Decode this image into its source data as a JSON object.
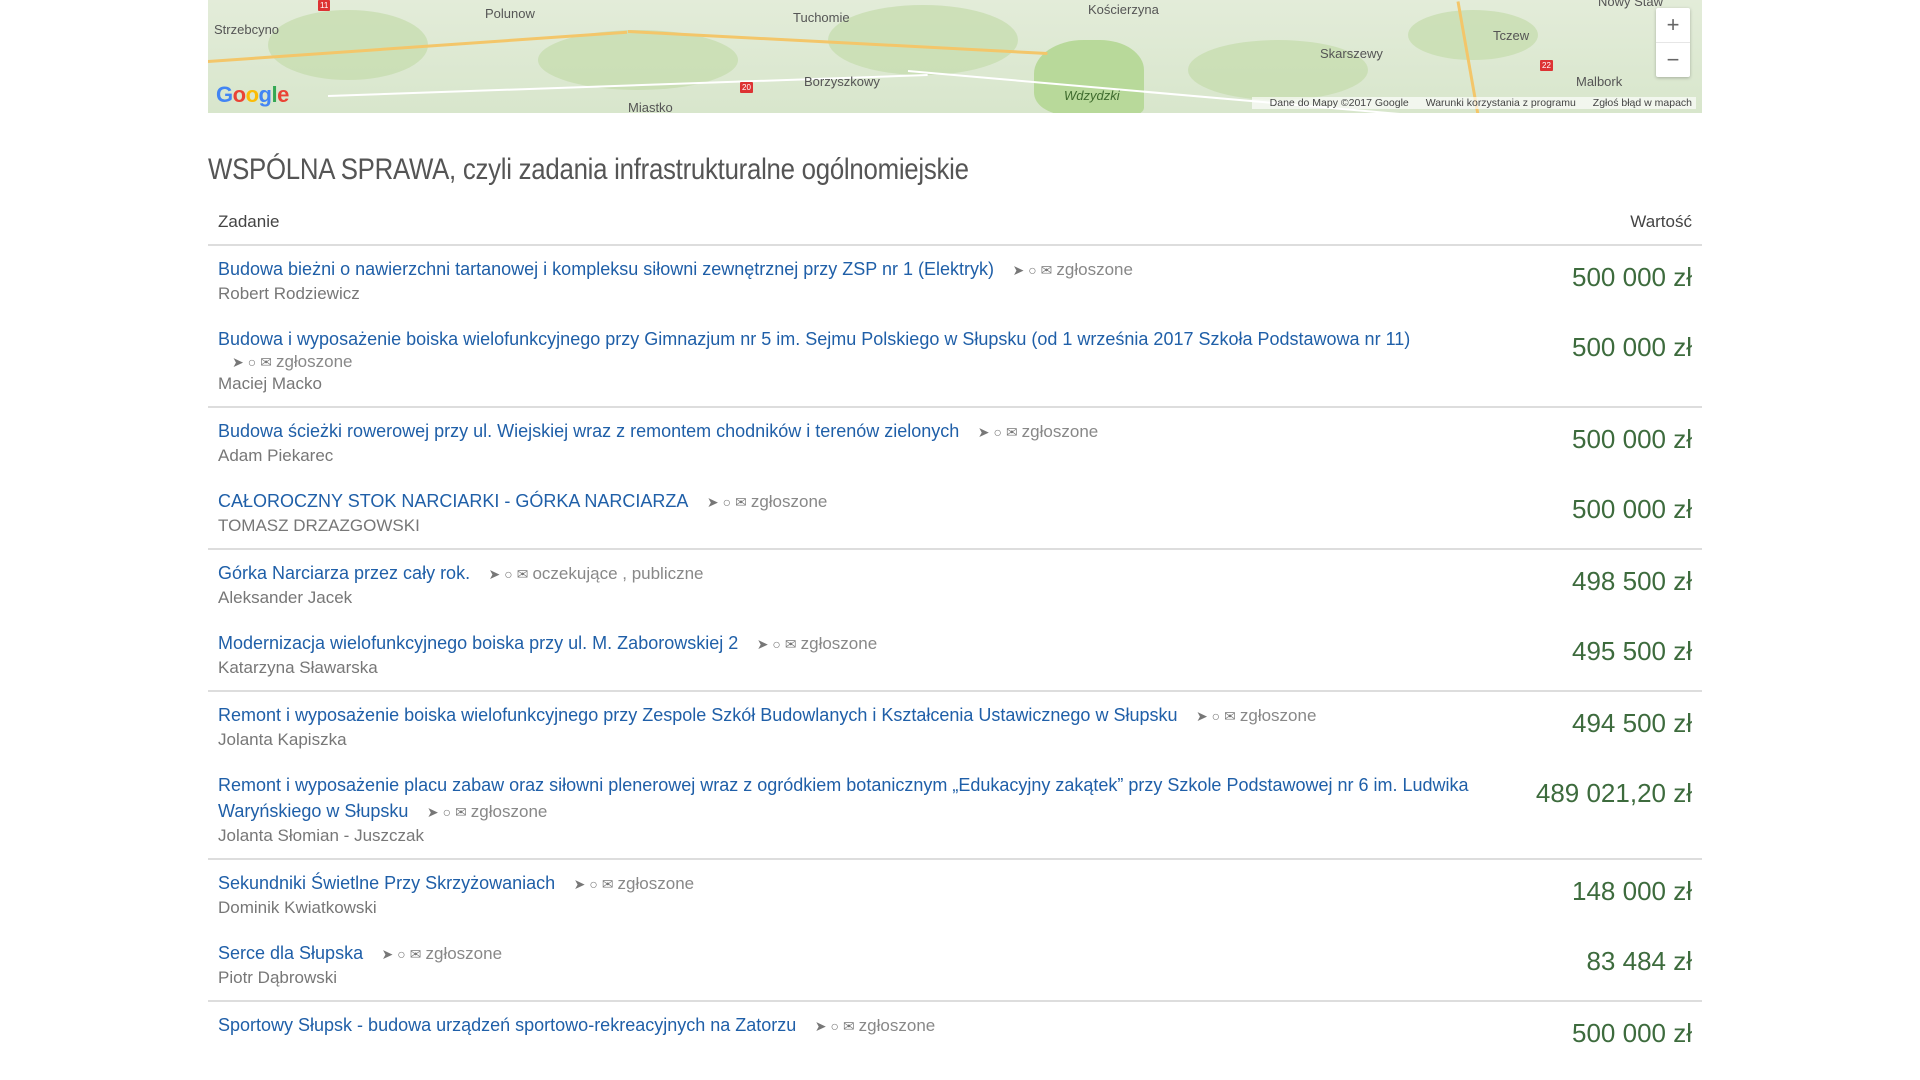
{
  "map": {
    "cities": [
      "Strzebcyno",
      "Polunow",
      "Tuchomie",
      "Kościerzyna",
      "Nowy Staw",
      "Tczew",
      "Skarszewy",
      "Borzyszkowy",
      "Miastko",
      "Malbork"
    ],
    "park_label": "Wdzydzki",
    "logo_letters": [
      "G",
      "o",
      "o",
      "g",
      "l",
      "e"
    ],
    "attribution": [
      "Dane do Mapy ©2017 Google",
      "Warunki korzystania z programu",
      "Zgłoś błąd w mapach"
    ],
    "zoom_in": "+",
    "zoom_out": "−",
    "shields": [
      "11",
      "20",
      "22"
    ]
  },
  "section_title": "WSPÓLNA SPRAWA, czyli zadania infrastrukturalne ogólnomiejskie",
  "table": {
    "col_task": "Zadanie",
    "col_value": "Wartość",
    "rows": [
      {
        "title": "Budowa bieżni o nawierzchni tartanowej i kompleksu siłowni zewnętrznej przy ZSP nr 1 (Elektryk)",
        "meta": "zgłoszone",
        "author": "Robert Rodziewicz",
        "value": "500 000 zł"
      },
      {
        "title": "Budowa i wyposażenie boiska wielofunkcyjnego przy Gimnazjum nr 5 im. Sejmu Polskiego w Słupsku (od 1 września 2017 Szkoła Podstawowa nr 11)",
        "meta": "zgłoszone",
        "author": "Maciej Macko",
        "value": "500 000 zł"
      },
      {
        "title": "Budowa ścieżki rowerowej przy ul. Wiejskiej wraz z remontem chodników i terenów zielonych",
        "meta": "zgłoszone",
        "author": "Adam Piekarec",
        "value": "500 000 zł"
      },
      {
        "title": "CAŁOROCZNY STOK NARCIARKI - GÓRKA NARCIARZA",
        "meta": "zgłoszone",
        "author": "TOMASZ DRZAZGOWSKI",
        "value": "500 000 zł"
      },
      {
        "title": "Górka Narciarza przez cały rok.",
        "meta": "oczekujące , publiczne",
        "author": "Aleksander Jacek",
        "value": "498 500 zł"
      },
      {
        "title": "Modernizacja wielofunkcyjnego boiska przy ul. M. Zaborowskiej 2",
        "meta": "zgłoszone",
        "author": "Katarzyna Sławarska",
        "value": "495 500 zł"
      },
      {
        "title": "Remont i wyposażenie boiska wielofunkcyjnego przy Zespole Szkół Budowlanych i Kształcenia Ustawicznego w Słupsku",
        "meta": "zgłoszone",
        "author": "Jolanta Kapiszka",
        "value": "494 500 zł"
      },
      {
        "title": "Remont i wyposażenie placu zabaw oraz siłowni plenerowej wraz z ogródkiem botanicznym „Edukacyjny zakątek” przy Szkole Podstawowej nr 6 im. Ludwika Waryńskiego w Słupsku",
        "meta": "zgłoszone",
        "author": "Jolanta Słomian - Juszczak",
        "value": "489 021,20 zł"
      },
      {
        "title": "Sekundniki Świetlne Przy Skrzyżowaniach",
        "meta": "zgłoszone",
        "author": "Dominik Kwiatkowski",
        "value": "148 000 zł"
      },
      {
        "title": "Serce dla Słupska",
        "meta": "zgłoszone",
        "author": "Piotr Dąbrowski",
        "value": "83 484 zł"
      },
      {
        "title": "Sportowy Słupsk - budowa urządzeń sportowo-rekreacyjnych na Zatorzu",
        "meta": "zgłoszone",
        "author": "",
        "value": "500 000 zł"
      }
    ]
  },
  "colors": {
    "link": "#1f5fa8",
    "value": "#3d6b3d",
    "divider": "#dddddd"
  },
  "icons": [
    "location-arrow-icon",
    "comment-icon",
    "envelope-icon"
  ]
}
